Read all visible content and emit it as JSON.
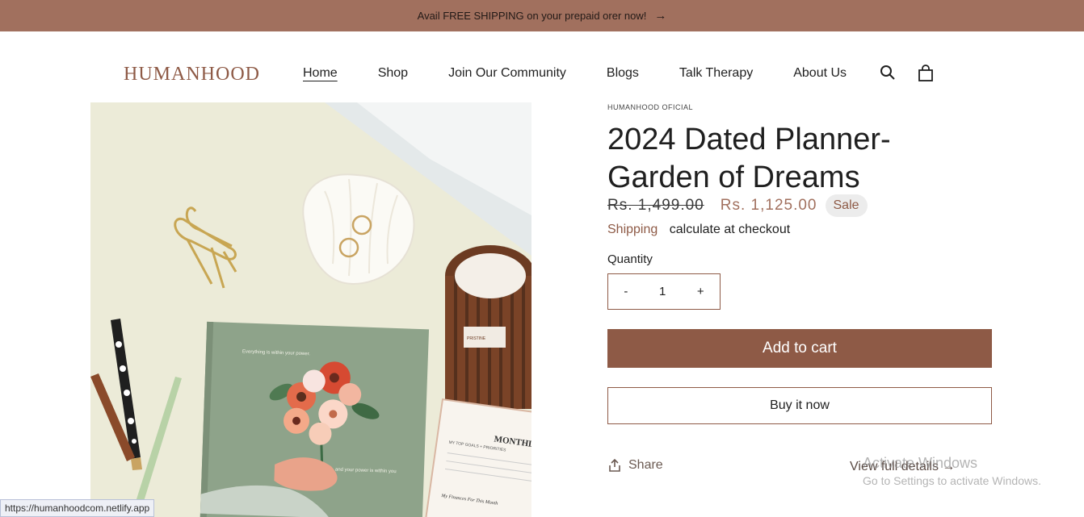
{
  "announcement": {
    "text": "Avail FREE SHIPPING on your prepaid orer now!",
    "arrow": "→"
  },
  "header": {
    "logo": "HUMANHOOD",
    "nav": [
      "Home",
      "Shop",
      "Join Our Community",
      "Blogs",
      "Talk Therapy",
      "About Us"
    ],
    "active_nav": "Home"
  },
  "product": {
    "vendor": "HUMANHOOD OFICIAL",
    "title": "2024 Dated Planner- Garden of Dreams",
    "price_old": "Rs. 1,499.00",
    "price_new": "Rs. 1,125.00",
    "badge": "Sale",
    "shipping_link": "Shipping",
    "shipping_text": "calculate at checkout",
    "quantity_label": "Quantity",
    "qty_minus": "-",
    "qty_value": "1",
    "qty_plus": "+",
    "add_to_cart": "Add to cart",
    "buy_now": "Buy it now",
    "share": "Share",
    "view_full": "View full details →"
  },
  "image_text": {
    "book_top": "Everything is within your power.",
    "book_bottom": "and your power is within you",
    "notebook_heading": "MONTHL",
    "notebook_goals": "MY TOP GOALS + PRIORITIES",
    "notebook_bottom": "My Finances For This Month",
    "candle_label": "PRISTINE"
  },
  "watermark": {
    "line1": "Activate Windows",
    "line2": "Go to Settings to activate Windows."
  },
  "status_url": "https://humanhoodcom.netlify.app",
  "colors": {
    "brand": "#8e5a46",
    "announce_bg": "#a1705e",
    "price_sale": "#a1705e"
  }
}
